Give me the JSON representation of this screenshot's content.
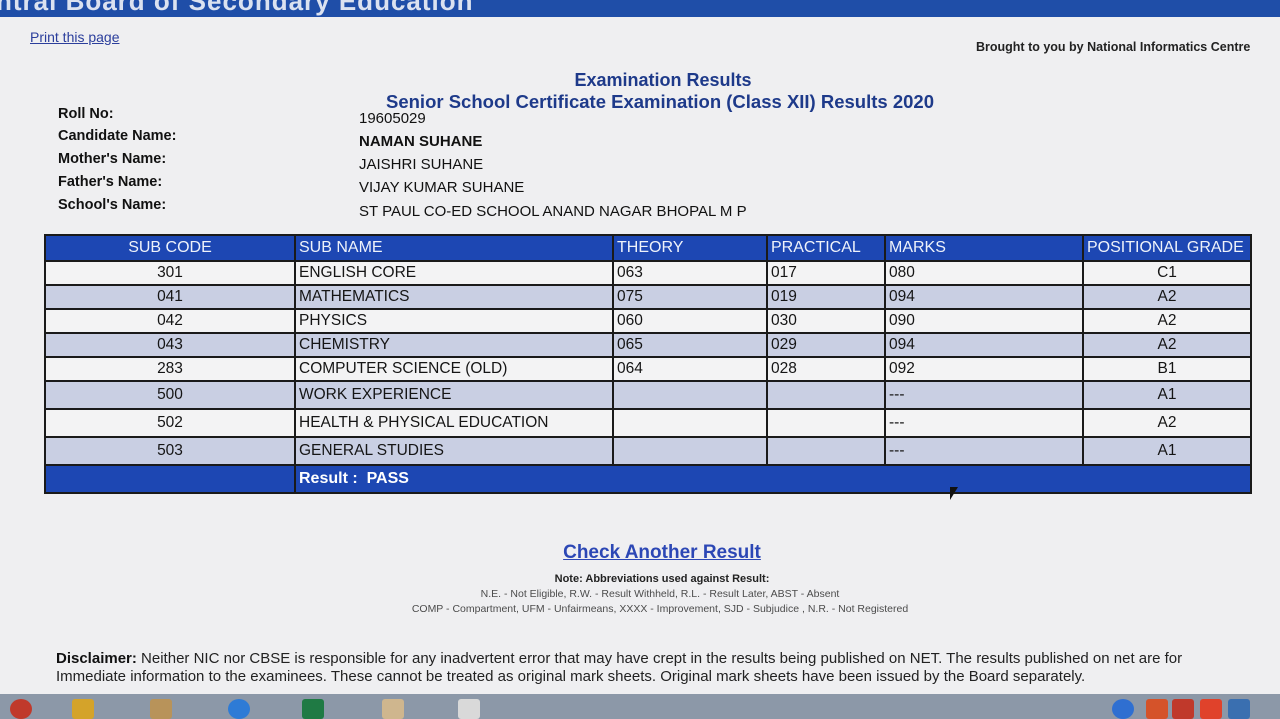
{
  "banner": {
    "text": "ntral Board of Secondary Education"
  },
  "header": {
    "print_link": "Print this page",
    "credit": "Brought to you by National Informatics Centre",
    "title": "Examination Results",
    "subtitle": "Senior School Certificate Examination (Class XII) Results 2020"
  },
  "candidate": {
    "roll_label": "Roll No:",
    "roll_value": "19605029",
    "name_label": "Candidate Name:",
    "name_value": "NAMAN SUHANE",
    "mother_label": "Mother's Name:",
    "mother_value": "JAISHRI SUHANE",
    "father_label": "Father's Name:",
    "father_value": "VIJAY KUMAR SUHANE",
    "school_label": "School's Name:",
    "school_value": "ST PAUL CO-ED SCHOOL ANAND NAGAR BHOPAL M P"
  },
  "table": {
    "headers": {
      "code": "SUB CODE",
      "name": "SUB NAME",
      "theory": "THEORY",
      "practical": "PRACTICAL",
      "marks": "MARKS",
      "grade": "POSITIONAL GRADE"
    },
    "rows": [
      {
        "code": "301",
        "name": "ENGLISH CORE",
        "theory": "063",
        "practical": "017",
        "marks": "080",
        "grade": "C1"
      },
      {
        "code": "041",
        "name": "MATHEMATICS",
        "theory": "075",
        "practical": "019",
        "marks": "094",
        "grade": "A2"
      },
      {
        "code": "042",
        "name": "PHYSICS",
        "theory": "060",
        "practical": "030",
        "marks": "090",
        "grade": "A2"
      },
      {
        "code": "043",
        "name": "CHEMISTRY",
        "theory": "065",
        "practical": "029",
        "marks": "094",
        "grade": "A2"
      },
      {
        "code": "283",
        "name": "COMPUTER SCIENCE (OLD)",
        "theory": "064",
        "practical": "028",
        "marks": "092",
        "grade": "B1"
      },
      {
        "code": "500",
        "name": "WORK EXPERIENCE",
        "theory": "",
        "practical": "",
        "marks": "---",
        "grade": "A1"
      },
      {
        "code": "502",
        "name": "HEALTH & PHYSICAL EDUCATION",
        "theory": "",
        "practical": "",
        "marks": "---",
        "grade": "A2"
      },
      {
        "code": "503",
        "name": "GENERAL STUDIES",
        "theory": "",
        "practical": "",
        "marks": "---",
        "grade": "A1"
      }
    ],
    "result_label": "Result :",
    "result_value": "PASS"
  },
  "footer": {
    "check_link": "Check Another Result",
    "note": "Note: Abbreviations used against Result:",
    "abbr_line1": "N.E. - Not Eligible, R.W. - Result Withheld, R.L. - Result Later, ABST - Absent",
    "abbr_line2": "COMP - Compartment, UFM - Unfairmeans, XXXX - Improvement, SJD - Subjudice , N.R. - Not Registered",
    "disclaimer_label": "Disclaimer:",
    "disclaimer_text": "Neither NIC nor CBSE is responsible for any inadvertent error that may have crept in the results being published on NET. The results published on net are for Immediate information to the examinees. These cannot be treated as original mark sheets. Original mark sheets have been issued by the Board separately."
  },
  "colors": {
    "header_blue": "#1d47b3",
    "title_blue": "#1e3a8a",
    "row_alt": "#c9cfe3",
    "link_blue": "#2c47b5"
  },
  "taskbar": {
    "icons": [
      "browser-icon",
      "folder-icon",
      "app-icon",
      "edge-icon",
      "excel-icon",
      "image-icon",
      "pdf-icon",
      "help-icon",
      "office-icon",
      "antivirus-icon",
      "store-icon",
      "terminal-icon"
    ]
  }
}
